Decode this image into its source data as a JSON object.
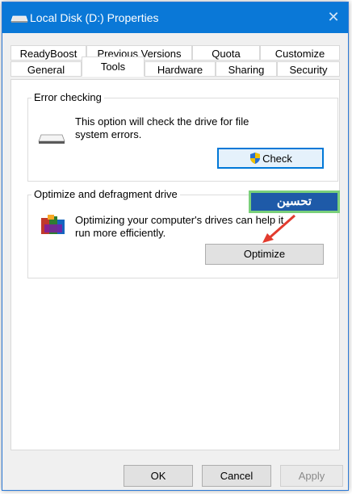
{
  "window": {
    "title": "Local Disk (D:) Properties"
  },
  "tabs": {
    "row1": [
      "ReadyBoost",
      "Previous Versions",
      "Quota",
      "Customize"
    ],
    "row2": [
      "General",
      "Tools",
      "Hardware",
      "Sharing",
      "Security"
    ],
    "active": "Tools"
  },
  "error_checking": {
    "title": "Error checking",
    "description": "This option will check the drive for file system errors.",
    "button": "Check"
  },
  "optimize": {
    "title": "Optimize and defragment drive",
    "description": "Optimizing your computer's drives can help it run more efficiently.",
    "button": "Optimize"
  },
  "annotation": {
    "text": "تحسين"
  },
  "footer": {
    "ok": "OK",
    "cancel": "Cancel",
    "apply": "Apply"
  },
  "icons": {
    "title": "drive-icon",
    "close": "close-icon",
    "error_check": "hard-drive-icon",
    "optimize": "defrag-icon",
    "shield": "uac-shield-icon",
    "arrow": "red-arrow-icon"
  },
  "colors": {
    "titlebar": "#0a78d7",
    "accent": "#0078d7",
    "annotation_bg": "#1e5aa8",
    "annotation_border": "#7ad07a",
    "arrow": "#e23b2e"
  }
}
